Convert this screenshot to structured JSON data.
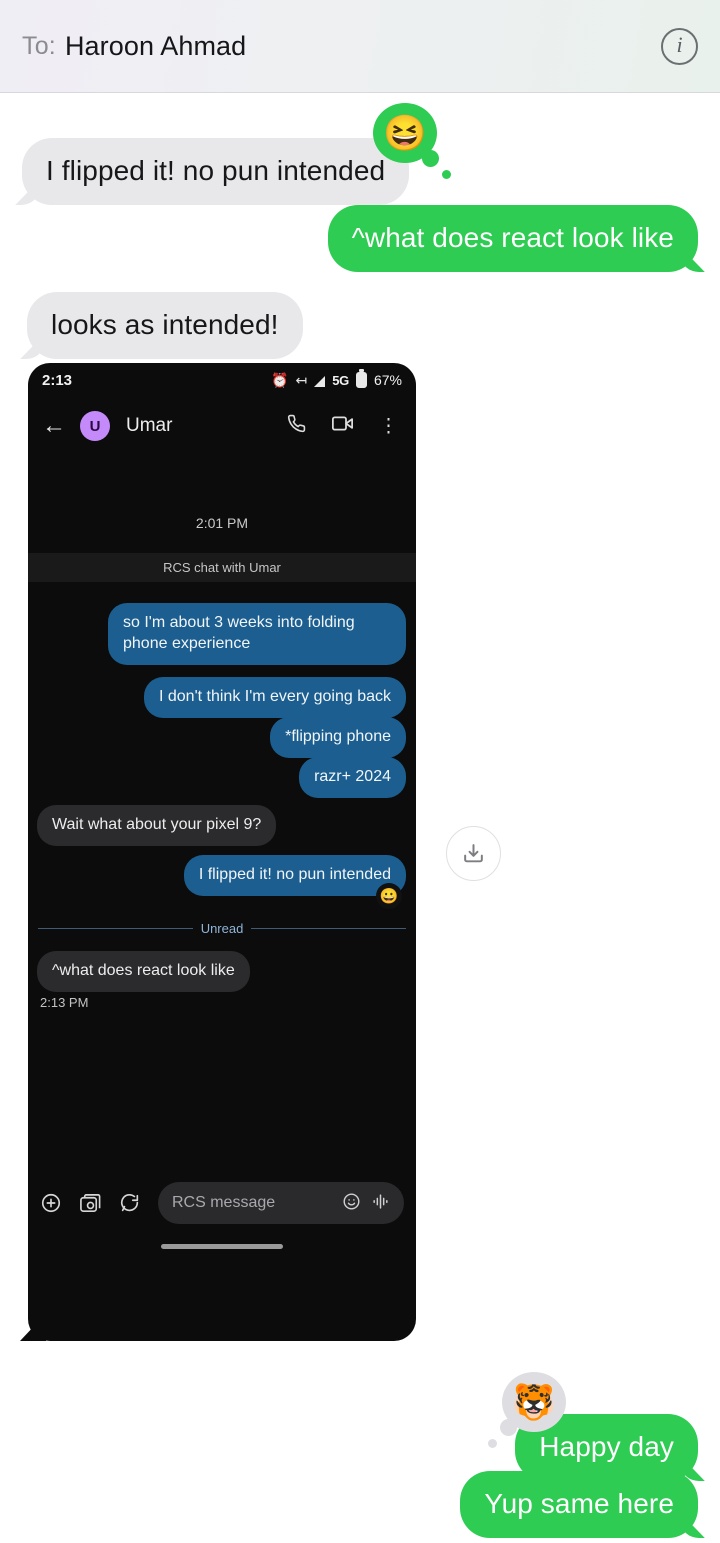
{
  "header": {
    "to_label": "To:",
    "recipient": "Haroon Ahmad",
    "info_icon": "info-icon"
  },
  "thread": [
    {
      "id": "msg-1",
      "side": "received",
      "text": "I flipped it! no pun intended",
      "reaction": {
        "emoji": "😆",
        "style": "sent-green"
      }
    },
    {
      "id": "msg-2",
      "side": "sent",
      "text": "^what does react look like"
    },
    {
      "id": "msg-3",
      "side": "received",
      "text": "looks as intended!"
    },
    {
      "id": "msg-4",
      "side": "received",
      "type": "image-attachment",
      "attachment_label": "phone-screenshot"
    },
    {
      "id": "msg-5",
      "side": "sent",
      "text": "Happy day",
      "reaction": {
        "emoji": "🐯",
        "style": "received-gray"
      }
    },
    {
      "id": "msg-6",
      "side": "sent",
      "text": "Yup same here"
    }
  ],
  "download_button": {
    "icon": "download-icon",
    "label": ""
  },
  "screenshot": {
    "status_bar": {
      "time": "2:13",
      "alarm_icon": "alarm-icon",
      "bluetooth_icon": "bluetooth-icon",
      "signal_icon": "signal-icon",
      "network": "5G",
      "battery_icon": "battery-icon",
      "battery": "67%"
    },
    "app_bar": {
      "back_icon": "back-arrow-icon",
      "avatar_initial": "U",
      "contact_name": "Umar",
      "call_icon": "phone-icon",
      "video_icon": "video-camera-icon",
      "overflow_icon": "more-vert-icon"
    },
    "daystamp": "2:01 PM",
    "rcs_banner": "RCS chat with Umar",
    "messages": [
      {
        "id": "s1",
        "side": "out",
        "text": "so I'm about 3 weeks into folding phone experience"
      },
      {
        "id": "s2",
        "side": "out",
        "text": "I don't think I'm every going back"
      },
      {
        "id": "s3",
        "side": "out",
        "text": "*flipping phone"
      },
      {
        "id": "s4",
        "side": "out",
        "text": "razr+ 2024"
      },
      {
        "id": "s5",
        "side": "in",
        "text": "Wait what about your pixel 9?"
      },
      {
        "id": "s6",
        "side": "out",
        "text": "I flipped it! no pun intended",
        "reaction": "😀"
      },
      {
        "id": "s7",
        "side": "in",
        "text": "^what does react look like"
      }
    ],
    "unread_divider": "Unread",
    "last_timestamp": "2:13 PM",
    "composer": {
      "plus_icon": "plus-circle-icon",
      "gallery_icon": "gallery-camera-icon",
      "sticker_icon": "sticker-icon",
      "placeholder": "RCS message",
      "emoji_icon": "emoji-smiley-icon",
      "voice_icon": "voice-waveform-icon"
    }
  },
  "colors": {
    "sent_bubble": "#2ecc52",
    "received_bubble": "#e8e8ea",
    "screenshot_out_bubble": "#1b5e8f",
    "screenshot_in_bubble": "#2b2b2e",
    "avatar": "#c58af9",
    "unread_accent": "#8fb4d8"
  }
}
